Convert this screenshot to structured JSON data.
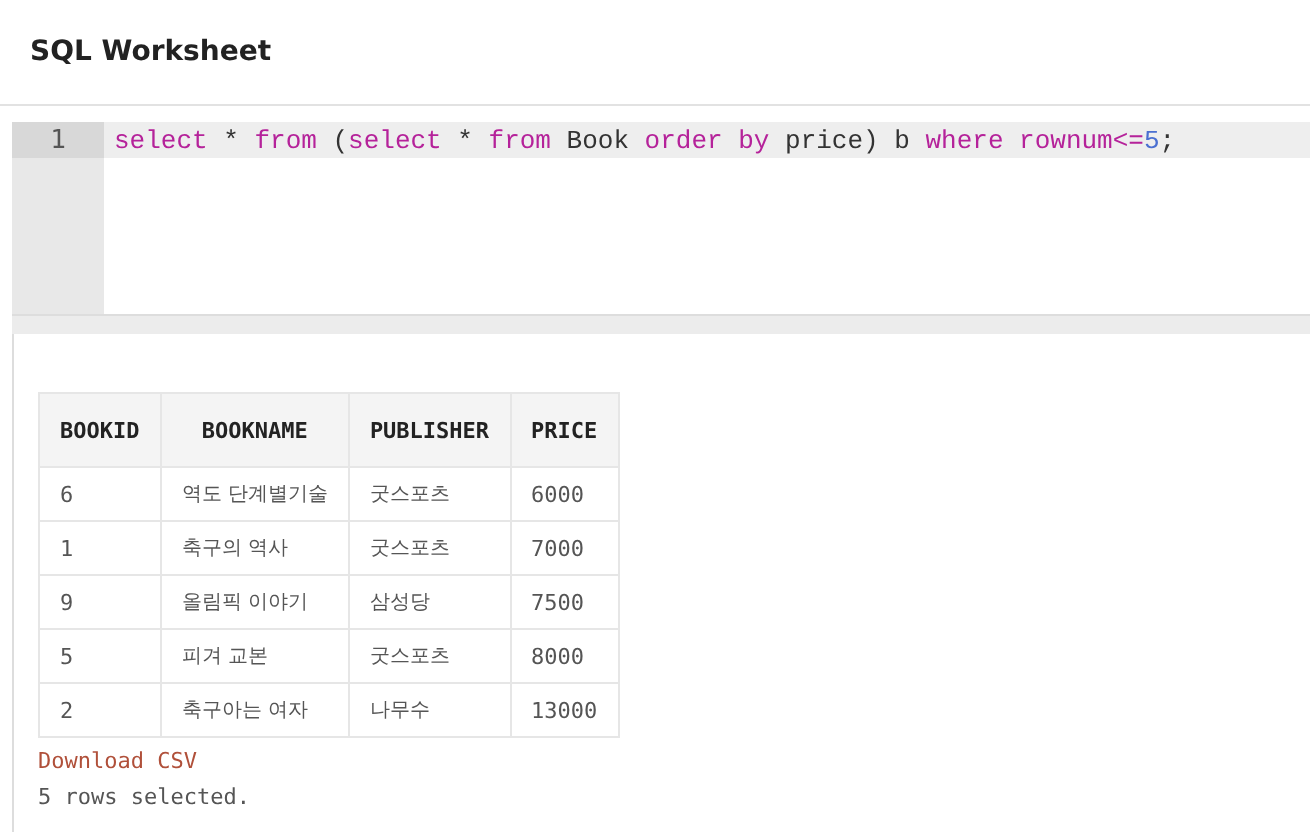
{
  "header": {
    "title": "SQL Worksheet"
  },
  "editor": {
    "lines": [
      {
        "number": "1",
        "tokens": [
          {
            "kind": "keyword",
            "text": "select"
          },
          {
            "kind": "plain",
            "text": " * "
          },
          {
            "kind": "keyword",
            "text": "from"
          },
          {
            "kind": "plain",
            "text": " ("
          },
          {
            "kind": "keyword",
            "text": "select"
          },
          {
            "kind": "plain",
            "text": " * "
          },
          {
            "kind": "keyword",
            "text": "from"
          },
          {
            "kind": "plain",
            "text": " Book "
          },
          {
            "kind": "keyword",
            "text": "order by"
          },
          {
            "kind": "plain",
            "text": " price) b "
          },
          {
            "kind": "keyword",
            "text": "where"
          },
          {
            "kind": "keyword",
            "text": " rownum<="
          },
          {
            "kind": "number",
            "text": "5"
          },
          {
            "kind": "plain",
            "text": ";"
          }
        ]
      }
    ]
  },
  "results": {
    "columns": [
      "BOOKID",
      "BOOKNAME",
      "PUBLISHER",
      "PRICE"
    ],
    "rows": [
      [
        "6",
        "역도 단계별기술",
        "굿스포츠",
        "6000"
      ],
      [
        "1",
        "축구의 역사",
        "굿스포츠",
        "7000"
      ],
      [
        "9",
        "올림픽 이야기",
        "삼성당",
        "7500"
      ],
      [
        "5",
        "피겨 교본",
        "굿스포츠",
        "8000"
      ],
      [
        "2",
        "축구아는 여자",
        "나무수",
        "13000"
      ]
    ],
    "download_link": "Download CSV",
    "status": "5 rows selected."
  }
}
